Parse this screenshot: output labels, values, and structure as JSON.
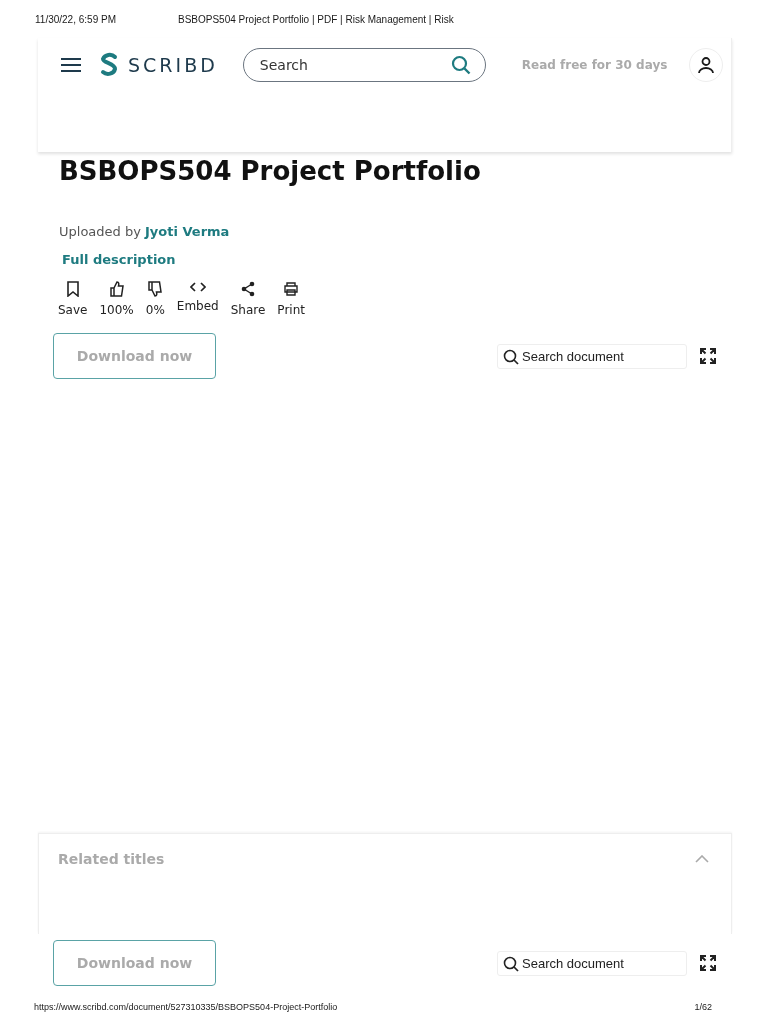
{
  "print_header": {
    "datetime": "11/30/22, 6:59 PM",
    "page_title": "BSBOPS504 Project Portfolio | PDF | Risk Management | Risk"
  },
  "header": {
    "logo": "SCRIBD",
    "search": {
      "placeholder": "Search"
    },
    "trial_link": "Read free for 30 days"
  },
  "document": {
    "title": "BSBOPS504 Project Portfolio",
    "uploaded_by_label": "Uploaded by",
    "uploader": "Jyoti Verma",
    "description_link": "Full description",
    "actions": [
      {
        "label": "Save"
      },
      {
        "label": "100%"
      },
      {
        "label": "0%"
      },
      {
        "label": "Embed"
      },
      {
        "label": "Share"
      },
      {
        "label": "Print"
      }
    ],
    "download_button": "Download now",
    "search": {
      "placeholder": "Search document"
    }
  },
  "related": {
    "title": "Related titles",
    "expanded": true
  },
  "bottom_bar": {
    "download_button": "Download now",
    "search": {
      "placeholder": "Search document"
    }
  },
  "print_footer": {
    "url": "https://www.scribd.com/document/527310335/BSBOPS504-Project-Portfolio",
    "page": "1/62"
  }
}
